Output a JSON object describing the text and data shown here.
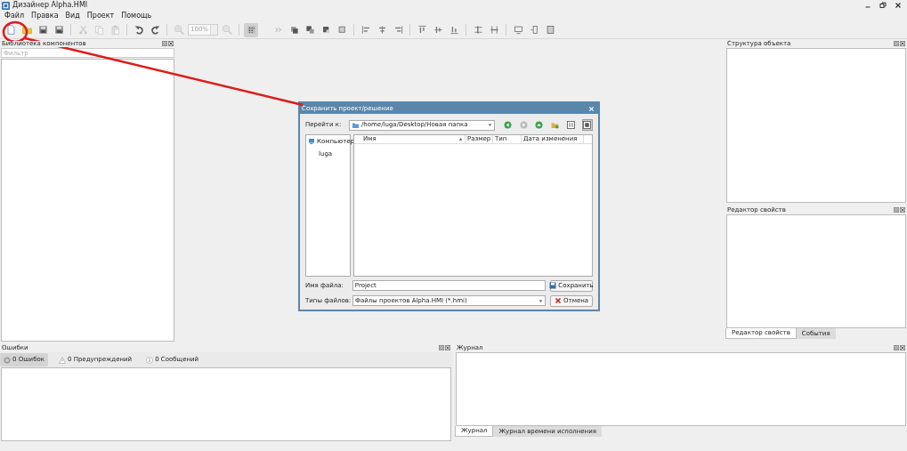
{
  "window": {
    "title": "Дизайнер Alpha.HMI"
  },
  "menu": [
    "Файл",
    "Правка",
    "Вид",
    "Проект",
    "Помощь"
  ],
  "toolbar": [
    {
      "kind": "button",
      "disabled": false
    },
    {
      "kind": "button",
      "disabled": false
    },
    {
      "kind": "button",
      "disabled": false
    },
    {
      "kind": "button",
      "disabled": false
    },
    {
      "kind": "separator"
    },
    {
      "kind": "button",
      "disabled": true
    },
    {
      "kind": "button",
      "disabled": true
    },
    {
      "kind": "button",
      "disabled": true
    },
    {
      "kind": "separator"
    },
    {
      "kind": "button",
      "disabled": false
    },
    {
      "kind": "button",
      "disabled": false
    },
    {
      "kind": "separator"
    },
    {
      "kind": "button",
      "disabled": true
    },
    {
      "kind": "zoom",
      "value": "100%"
    },
    {
      "kind": "button",
      "disabled": true
    },
    {
      "kind": "separator"
    },
    {
      "kind": "button",
      "disabled": false,
      "pressed": true
    },
    {
      "kind": "spacer"
    },
    {
      "kind": "button",
      "disabled": false
    },
    {
      "kind": "button",
      "disabled": false
    },
    {
      "kind": "button",
      "disabled": false
    },
    {
      "kind": "button",
      "disabled": false
    },
    {
      "kind": "button",
      "disabled": false
    },
    {
      "kind": "separator"
    },
    {
      "kind": "button",
      "disabled": false
    },
    {
      "kind": "button",
      "disabled": false
    },
    {
      "kind": "button",
      "disabled": false
    },
    {
      "kind": "separator"
    },
    {
      "kind": "button",
      "disabled": false
    },
    {
      "kind": "button",
      "disabled": false
    },
    {
      "kind": "button",
      "disabled": false
    },
    {
      "kind": "separator"
    },
    {
      "kind": "button",
      "disabled": false
    },
    {
      "kind": "button",
      "disabled": false
    },
    {
      "kind": "separator"
    },
    {
      "kind": "button",
      "disabled": false
    },
    {
      "kind": "button",
      "disabled": false
    },
    {
      "kind": "button",
      "disabled": false
    }
  ],
  "library_panel": {
    "title": "Библиотека компонентов",
    "filter": {
      "placeholder": "Фильтр"
    }
  },
  "structure_panel": {
    "title": "Структура объекта"
  },
  "properties_panel": {
    "title": "Редактор свойств",
    "tabs": [
      {
        "label": "Редактор свойств",
        "selected": true
      },
      {
        "label": "События",
        "selected": false
      }
    ]
  },
  "errors_panel": {
    "title": "Ошибки",
    "tabs": [
      {
        "label": "0 Ошибок",
        "kind": "error",
        "selected": true
      },
      {
        "label": "0 Предупреждений",
        "kind": "warning",
        "selected": false
      },
      {
        "label": "0 Сообщений",
        "kind": "info",
        "selected": false
      }
    ]
  },
  "log_panel": {
    "title": "Журнал",
    "tabs": [
      {
        "label": "Журнал",
        "selected": true
      },
      {
        "label": "Журнал времени исполнения",
        "selected": false
      }
    ]
  },
  "dialog": {
    "title": "Сохранить проект/решение",
    "look_in_label": "Перейти к:",
    "look_in_value": "/home/luga/Desktop/Новая папка",
    "places": [
      {
        "label": "Компьютер",
        "kind": "computer"
      },
      {
        "label": "luga",
        "kind": "folder"
      }
    ],
    "columns": [
      "Имя",
      "Размер",
      "Тип",
      "Дата изменения"
    ],
    "file_name_label": "Имя файла:",
    "file_name": "Project",
    "file_types_label": "Типы файлов:",
    "file_types_value": "Файлы проектов Alpha.HMI (*.hmi)",
    "buttons": [
      {
        "kind": "save",
        "label": "Сохранить"
      },
      {
        "kind": "cancel",
        "label": "Отмена"
      }
    ]
  }
}
